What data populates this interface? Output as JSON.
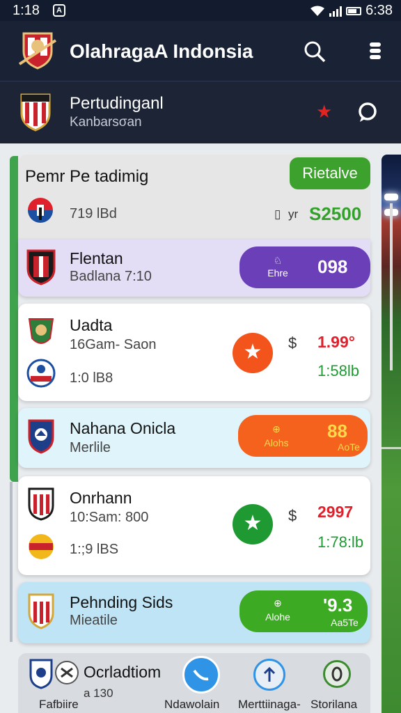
{
  "status": {
    "time": "1:18",
    "notif": "A",
    "clock": "6:38"
  },
  "appbar": {
    "title": "OlahragaA Indonsia"
  },
  "subbar": {
    "title": "Pertudinganl",
    "subtitle": "Kanbarsσan"
  },
  "header_card": {
    "title": "Pemr Pe tadimig",
    "button": "Rietalve",
    "sub": "719 lBd",
    "yr": "yr",
    "amount": "S2500"
  },
  "matches": [
    {
      "name": "Flentan",
      "sub": "Badlana 7:10",
      "pill_small": "Ehre",
      "pill_big": "098",
      "pill_color": "#6a3fb8"
    },
    {
      "name": "Uadta",
      "sub": "16Gam- Saon",
      "sub2": "1:0 lB8",
      "odd1": "1.99°",
      "odd2": "1:58lb",
      "circle_color": "#f2541b"
    },
    {
      "name": "Nahana Oniclа",
      "sub": "Merlile",
      "pill_small": "Alohs",
      "pill_small2": "AoTe",
      "pill_big": "88",
      "pill_color": "#f4621e"
    },
    {
      "name": "Onrhann",
      "sub": "10:Sam: 800",
      "sub2": "1:;9 lBS",
      "odd1": "2997",
      "odd2": "1:78:lb",
      "circle_color": "#1f9a33"
    },
    {
      "name": "Pehnding Sids",
      "sub": "Mieatile",
      "pill_small": "Alohe",
      "pill_big": "'9.3",
      "pill_small2": "Aa5Te",
      "pill_color": "#3caa22"
    }
  ],
  "bottom": {
    "title": "Ocrladtiom",
    "num": "a 130",
    "labels": [
      "Fafbiire",
      "Ndawolain",
      "Merttiinaga-",
      "Storilana"
    ]
  },
  "colors": {
    "primary": "#1a2335",
    "green": "#3da22d",
    "purple": "#6a3fb8",
    "orange": "#f4621e",
    "red": "#e0202a"
  }
}
